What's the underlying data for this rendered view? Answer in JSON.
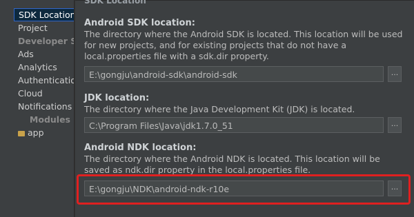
{
  "sidebar": {
    "items": [
      {
        "label": "SDK Location",
        "kind": "selected"
      },
      {
        "label": "Project",
        "kind": "item"
      },
      {
        "label": "Developer Ser",
        "kind": "group"
      },
      {
        "label": "Ads",
        "kind": "item"
      },
      {
        "label": "Analytics",
        "kind": "item"
      },
      {
        "label": "Authenticatior",
        "kind": "item"
      },
      {
        "label": "Cloud",
        "kind": "item"
      },
      {
        "label": "Notifications",
        "kind": "item"
      },
      {
        "label": "Modules",
        "kind": "group-right"
      },
      {
        "label": "app",
        "kind": "module"
      }
    ]
  },
  "header": {
    "title": "SDK Location"
  },
  "sdk": {
    "title": "Android SDK location:",
    "description": "The directory where the Android SDK is located. This location will be used for new projects, and for existing projects that do not have a local.properties file with a sdk.dir property.",
    "path": "E:\\gongju\\android-sdk\\android-sdk",
    "browse": "..."
  },
  "jdk": {
    "title": "JDK location:",
    "description": "The directory where the Java Development Kit (JDK) is located.",
    "path": "C:\\Program Files\\Java\\jdk1.7.0_51",
    "browse": "..."
  },
  "ndk": {
    "title": "Android NDK location:",
    "description": "The directory where the Android NDK is located. This location will be saved as ndk.dir property in the local.properties file.",
    "path": "E:\\gongju\\NDK\\android-ndk-r10e",
    "browse": "..."
  },
  "colors": {
    "highlight": "#e02020",
    "selection": "#0d293e"
  }
}
